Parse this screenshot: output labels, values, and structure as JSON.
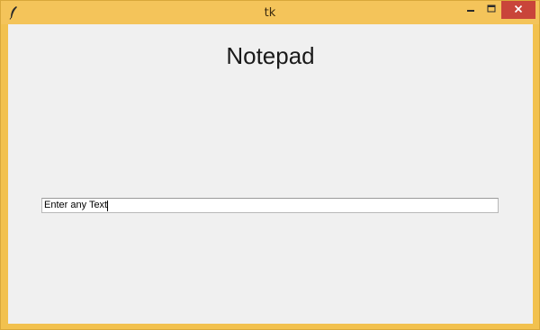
{
  "window": {
    "title": "tk",
    "icon": "feather-icon",
    "accent_color": "#f4c45a",
    "close_color": "#c9453a"
  },
  "controls": {
    "minimize_icon": "minimize-icon",
    "maximize_icon": "maximize-icon",
    "close_icon": "close-icon"
  },
  "main": {
    "heading": "Notepad",
    "entry_value": "Enter any Text"
  }
}
